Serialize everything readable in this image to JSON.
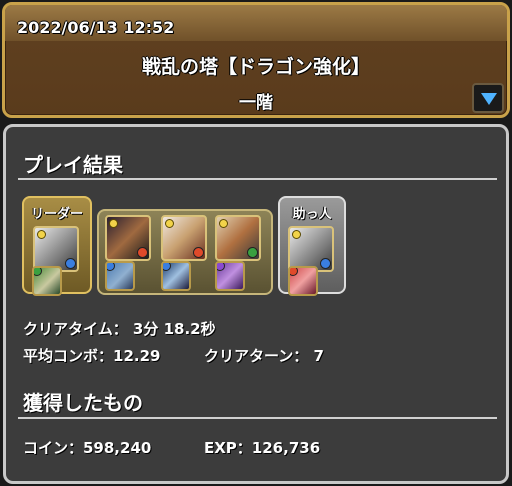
{
  "header": {
    "datetime": "2022/06/13 12:52",
    "dungeon_name": "戦乱の塔【ドラゴン強化】",
    "floor": "一階"
  },
  "result": {
    "section_title": "プレイ結果",
    "leader_label": "リーダー",
    "helper_label": "助っ人",
    "clear_time": "クリアタイム： 3分 18.2秒",
    "avg_combo": "平均コンボ：12.29",
    "clear_turns": "クリアターン： 7"
  },
  "rewards": {
    "section_title": "獲得したもの",
    "coin": "コイン：598,240",
    "exp": "EXP：126,736"
  },
  "colors": {
    "header_border": "#c9a24a",
    "panel_border": "#c8c8c8",
    "panel_bg": "#3c3c3c",
    "dropdown_arrow": "#4fb3ff",
    "fire_orb": "#e04a2a",
    "water_orb": "#3a7ee0",
    "dark_orb": "#8a4ad0",
    "wood_orb": "#3aa040"
  }
}
